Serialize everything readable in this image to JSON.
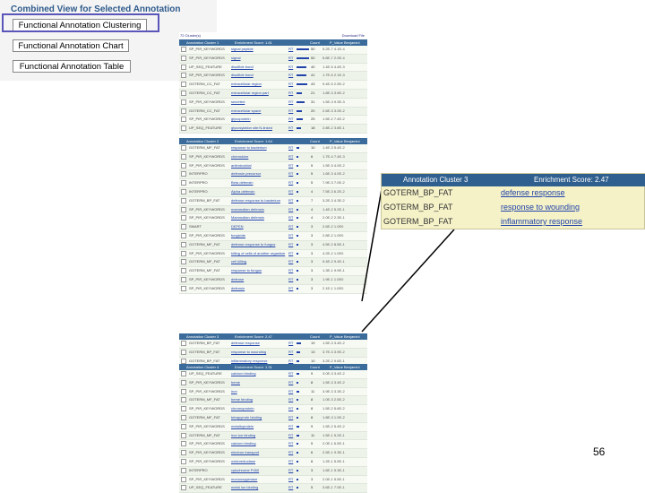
{
  "panel": {
    "title": "Combined View for Selected Annotation",
    "buttons": [
      "Functional Annotation Clustering",
      "Functional Annotation Chart",
      "Functional Annotation Table"
    ]
  },
  "table": {
    "summary_left": "72 Cluster(s)",
    "summary_right": "Download File",
    "cluster_headers": [
      {
        "label": "Annotation Cluster 1",
        "score": "Enrichment Score: 1.81",
        "count": "Count",
        "pvalue": "P_Value Benjamini"
      },
      {
        "label": "Annotation Cluster 2",
        "score": "Enrichment Score: 1.64",
        "count": "Count",
        "pvalue": "P_Value Benjamini"
      },
      {
        "label": "Annotation Cluster 3",
        "score": "Enrichment Score: 2.47",
        "count": "Count",
        "pvalue": "P_Value Benjamini"
      },
      {
        "label": "Annotation Cluster 4",
        "score": "Enrichment Score: 1.31",
        "count": "Count",
        "pvalue": "P_Value Benjamini"
      }
    ],
    "rt_label": "RT",
    "clusters": [
      [
        {
          "cat": "SP_PIR_KEYWORDS",
          "term": "signal peptide",
          "count": "50",
          "pv": "5.2E-7 4.1E-4"
        },
        {
          "cat": "SP_PIR_KEYWORDS",
          "term": "signal",
          "count": "50",
          "pv": "5.8E-7 2.0E-4"
        },
        {
          "cat": "UP_SEQ_FEATURE",
          "term": "disulfide bond",
          "count": "40",
          "pv": "1.4E-5 4.4E-3"
        },
        {
          "cat": "SP_PIR_KEYWORDS",
          "term": "disulfide bond",
          "count": "41",
          "pv": "1.7E-5 2.1E-3"
        },
        {
          "cat": "GOTERM_CC_FAT",
          "term": "extracellular region",
          "count": "43",
          "pv": "9.4E-5 2.5E-2"
        },
        {
          "cat": "GOTERM_CC_FAT",
          "term": "extracellular region part",
          "count": "21",
          "pv": "1.8E-3 3.6E-2"
        },
        {
          "cat": "SP_PIR_KEYWORDS",
          "term": "secreted",
          "count": "31",
          "pv": "1.5E-3 9.3E-3"
        },
        {
          "cat": "GOTERM_CC_FAT",
          "term": "extracellular space",
          "count": "20",
          "pv": "2.6E-3 3.0E-2"
        },
        {
          "cat": "SP_PIR_KEYWORDS",
          "term": "glycoprotein",
          "count": "25",
          "pv": "1.5E-2 7.4E-2"
        },
        {
          "cat": "UP_SEQ_FEATURE",
          "term": "glycosylation site:N-linked",
          "count": "18",
          "pv": "2.8E-2 3.8E-1"
        }
      ],
      [
        {
          "cat": "GOTERM_MF_FAT",
          "term": "response to bacterium",
          "count": "10",
          "pv": "1.4E-3 5.4E-2"
        },
        {
          "cat": "SP_PIR_KEYWORDS",
          "term": "chemokine",
          "count": "6",
          "pv": "1.7E-4 7.4E-3"
        },
        {
          "cat": "SP_PIR_KEYWORDS",
          "term": "antimicrobial",
          "count": "5",
          "pv": "1.5E-3 4.0E-2"
        },
        {
          "cat": "INTERPRO",
          "term": "defensin precursor",
          "count": "5",
          "pv": "1.6E-3 4.0E-2"
        },
        {
          "cat": "INTERPRO",
          "term": "Beta defensin",
          "count": "5",
          "pv": "7.9E-3 7.0E-2"
        },
        {
          "cat": "INTERPRO",
          "term": "Alpha defensin",
          "count": "4",
          "pv": "7.5E-3 6.2E-2"
        },
        {
          "cat": "GOTERM_BP_FAT",
          "term": "defense response to bacterium",
          "count": "7",
          "pv": "3.2E-3 4.3E-2"
        },
        {
          "cat": "SP_PIR_KEYWORDS",
          "term": "mammalian defensin",
          "count": "4",
          "pv": "1.4E-2 5.2E-1"
        },
        {
          "cat": "SP_PIR_KEYWORDS",
          "term": "Mammalian defensin",
          "count": "4",
          "pv": "2.0E-2 2.3E-1"
        },
        {
          "cat": "SMART",
          "term": "DEFEN",
          "count": "3",
          "pv": "2.6E-2 1.0E0"
        },
        {
          "cat": "SP_PIR_KEYWORDS",
          "term": "fungicide",
          "count": "3",
          "pv": "2.8E-2 1.0E0"
        },
        {
          "cat": "GOTERM_MF_FAT",
          "term": "defense response to fungus",
          "count": "3",
          "pv": "4.5E-2 8.5E-1"
        },
        {
          "cat": "SP_PIR_KEYWORDS",
          "term": "killing of cells of another organism",
          "count": "3",
          "pv": "4.2E-2 1.0E0"
        },
        {
          "cat": "GOTERM_MF_FAT",
          "term": "cell killing",
          "count": "3",
          "pv": "9.4E-2 9.4E-1"
        },
        {
          "cat": "GOTERM_MF_FAT",
          "term": "response to fungus",
          "count": "3",
          "pv": "1.3E-1 9.9E-1"
        },
        {
          "cat": "SP_PIR_KEYWORDS",
          "term": "defense",
          "count": "3",
          "pv": "1.9E-1 1.0E0"
        },
        {
          "cat": "SP_PIR_KEYWORDS",
          "term": "defensin",
          "count": "3",
          "pv": "2.1E-1 1.0E0"
        }
      ],
      [
        {
          "cat": "GOTERM_BP_FAT",
          "term": "defense response",
          "count": "19",
          "pv": "1.5E-3 3.4E-2"
        },
        {
          "cat": "GOTERM_BP_FAT",
          "term": "response to wounding",
          "count": "13",
          "pv": "3.7E-3 3.9E-2"
        },
        {
          "cat": "GOTERM_BP_FAT",
          "term": "inflammatory response",
          "count": "10",
          "pv": "3.2E-2 9.6E-1"
        }
      ],
      [
        {
          "cat": "UP_SEQ_FEATURE",
          "term": "calcium binding",
          "count": "9",
          "pv": "3.0E-3 3.4E-2"
        },
        {
          "cat": "SP_PIR_KEYWORDS",
          "term": "heme",
          "count": "8",
          "pv": "1.5E-3 3.4E-2"
        },
        {
          "cat": "SP_PIR_KEYWORDS",
          "term": "iron",
          "count": "11",
          "pv": "3.9E-3 3.3E-2"
        },
        {
          "cat": "GOTERM_MF_FAT",
          "term": "heme binding",
          "count": "8",
          "pv": "1.0E-3 2.5E-2"
        },
        {
          "cat": "SP_PIR_KEYWORDS",
          "term": "chromoprotein",
          "count": "8",
          "pv": "1.5E-2 5.6E-2"
        },
        {
          "cat": "GOTERM_MF_FAT",
          "term": "tetrapyrrole binding",
          "count": "8",
          "pv": "1.8E-3 1.0E-2"
        },
        {
          "cat": "SP_PIR_KEYWORDS",
          "term": "metalloprotein",
          "count": "9",
          "pv": "1.5E-2 5.4E-2"
        },
        {
          "cat": "GOTERM_MF_FAT",
          "term": "iron ion binding",
          "count": "11",
          "pv": "1.5E-1 5.2E-1"
        },
        {
          "cat": "SP_PIR_KEYWORDS",
          "term": "calcium binding",
          "count": "5",
          "pv": "2.0E-1 6.5E-1"
        },
        {
          "cat": "SP_PIR_KEYWORDS",
          "term": "electron transport",
          "count": "6",
          "pv": "2.5E-1 9.3E-1"
        },
        {
          "cat": "SP_PIR_KEYWORDS",
          "term": "oxidoreductase",
          "count": "8",
          "pv": "1.2E-1 5.5E-1"
        },
        {
          "cat": "INTERPRO",
          "term": "cytochrome P450",
          "count": "3",
          "pv": "1.6E-1 5.3E-1"
        },
        {
          "cat": "SP_PIR_KEYWORDS",
          "term": "monooxygenase",
          "count": "3",
          "pv": "2.0E-1 5.5E-1"
        },
        {
          "cat": "UP_SEQ_FEATURE",
          "term": "metal ion binding",
          "count": "5",
          "pv": "3.6E-1 7.0E-1"
        }
      ]
    ]
  },
  "zoom": {
    "title": "Annotation Cluster 3",
    "score": "Enrichment Score: 2.47",
    "rows": [
      {
        "cat": "GOTERM_BP_FAT",
        "term": "defense response"
      },
      {
        "cat": "GOTERM_BP_FAT",
        "term": "response to wounding"
      },
      {
        "cat": "GOTERM_BP_FAT",
        "term": "inflammatory response"
      }
    ]
  },
  "page_number": "56",
  "colors": {
    "header_blue": "#3a6b9a",
    "highlight_box": "#5a55b8",
    "zoom_bg": "#f5f2c8",
    "link": "#2244aa"
  }
}
